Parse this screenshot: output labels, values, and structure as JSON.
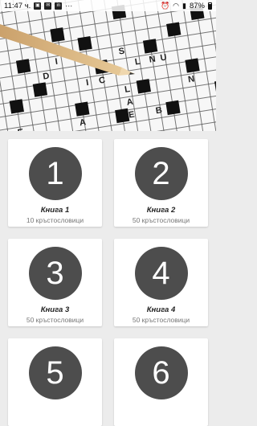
{
  "status_bar": {
    "time": "11:47 ч.",
    "battery": "87%",
    "more": "···"
  },
  "hero": {
    "letters": [
      "S",
      "L",
      "N",
      "U",
      "A",
      "E",
      "L",
      "I",
      "C",
      "D",
      "I",
      "N",
      "E",
      "B",
      "A"
    ]
  },
  "books": [
    {
      "number": "1",
      "title": "Книга 1",
      "count": "10 кръстословици"
    },
    {
      "number": "2",
      "title": "Книга 2",
      "count": "50 кръстословици"
    },
    {
      "number": "3",
      "title": "Книга 3",
      "count": "50 кръстословици"
    },
    {
      "number": "4",
      "title": "Книга 4",
      "count": "50 кръстословици"
    },
    {
      "number": "5",
      "title": "",
      "count": ""
    },
    {
      "number": "6",
      "title": "",
      "count": ""
    }
  ]
}
